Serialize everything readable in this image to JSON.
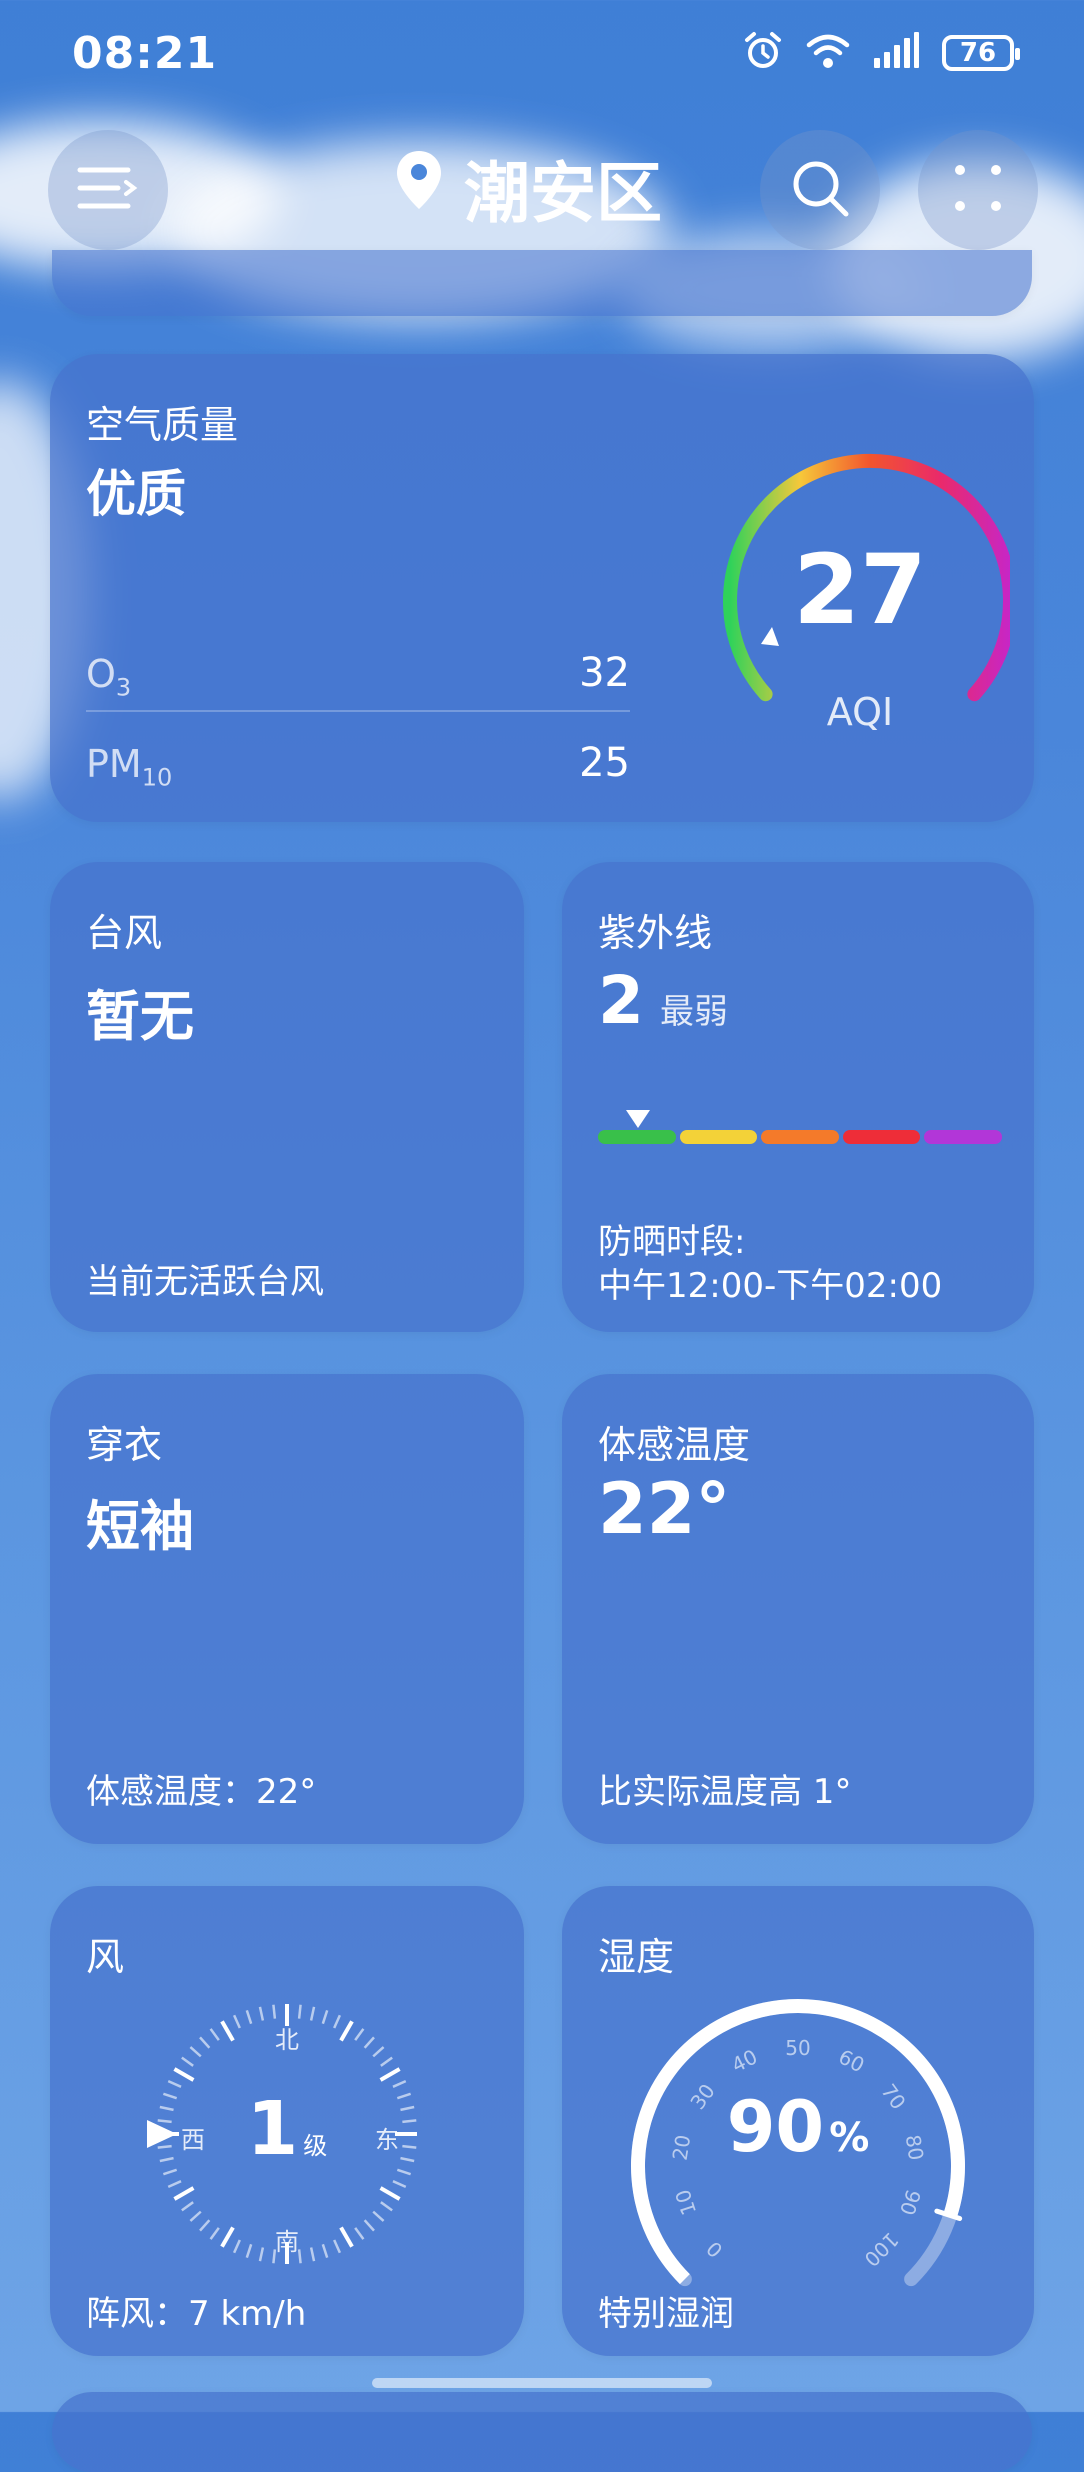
{
  "status_bar": {
    "time": "08:21",
    "battery": "76"
  },
  "header": {
    "location": "潮安区"
  },
  "air_quality": {
    "label": "空气质量",
    "status": "优质",
    "aqi_value": "27",
    "aqi_label": "AQI",
    "rows": [
      {
        "name": "O",
        "sub": "3",
        "value": "32"
      },
      {
        "name": "PM",
        "sub": "10",
        "value": "25"
      }
    ]
  },
  "typhoon": {
    "label": "台风",
    "value": "暂无",
    "note": "当前无活跃台风"
  },
  "uv": {
    "label": "紫外线",
    "value": "2",
    "level": "最弱",
    "note_title": "防晒时段:",
    "note_time": "中午12:00-下午02:00",
    "scale_colors": [
      "#39c04a",
      "#f3d238",
      "#f47a2a",
      "#ee2d38",
      "#b236d8"
    ],
    "marker_fraction": 0.1
  },
  "clothing": {
    "label": "穿衣",
    "value": "短袖",
    "note": "体感温度：22°"
  },
  "feels_like": {
    "label": "体感温度",
    "value": "22°",
    "note": "比实际温度高 1°"
  },
  "wind": {
    "label": "风",
    "level_value": "1",
    "level_unit": "级",
    "dir_n": "北",
    "dir_s": "南",
    "dir_e": "东",
    "dir_w": "西",
    "gust": "阵风：7 km/h"
  },
  "humidity": {
    "label": "湿度",
    "value": "90",
    "unit": "%",
    "status": "特别湿润",
    "ticks": [
      "0",
      "10",
      "20",
      "30",
      "40",
      "50",
      "60",
      "70",
      "80",
      "90",
      "100"
    ],
    "fraction": 0.9
  },
  "icons": [
    "menu-icon",
    "location-pin-icon",
    "search-icon",
    "more-dots-icon",
    "alarm-icon",
    "wifi-icon",
    "signal-icon",
    "battery-icon"
  ]
}
